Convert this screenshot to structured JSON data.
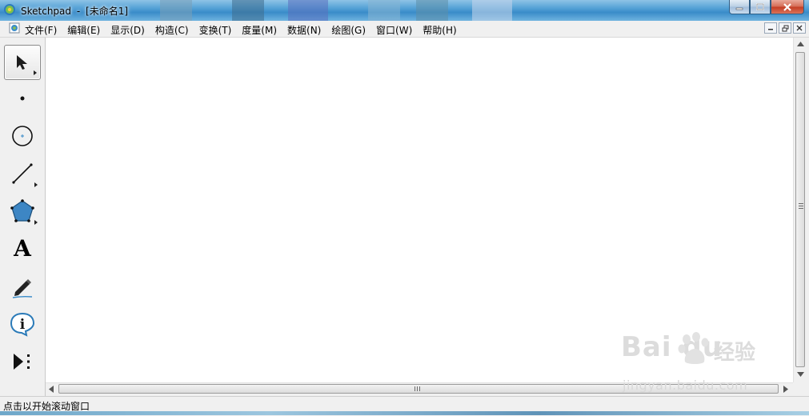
{
  "window": {
    "app_name": "Sketchpad",
    "separator": "-",
    "document": "[未命名1]"
  },
  "menu": {
    "items": [
      {
        "label": "文件(F)"
      },
      {
        "label": "编辑(E)"
      },
      {
        "label": "显示(D)"
      },
      {
        "label": "构造(C)"
      },
      {
        "label": "变换(T)"
      },
      {
        "label": "度量(M)"
      },
      {
        "label": "数据(N)"
      },
      {
        "label": "绘图(G)"
      },
      {
        "label": "窗口(W)"
      },
      {
        "label": "帮助(H)"
      }
    ]
  },
  "toolbox": {
    "tools": [
      {
        "icon": "arrow-select-icon",
        "selected": true
      },
      {
        "icon": "point-icon"
      },
      {
        "icon": "compass-circle-icon"
      },
      {
        "icon": "straightedge-icon"
      },
      {
        "icon": "polygon-icon"
      },
      {
        "icon": "text-tool-icon",
        "glyph": "A"
      },
      {
        "icon": "marker-icon"
      },
      {
        "icon": "information-icon"
      },
      {
        "icon": "custom-tool-icon"
      }
    ]
  },
  "status": {
    "text": "点击以开始滚动窗口"
  },
  "watermark": {
    "brand": "Bai du",
    "product": "经验",
    "url": "jingyan.baidu.com"
  },
  "colors": {
    "accent_blue": "#3a8cc9",
    "canvas": "#ffffff",
    "chrome": "#f0f0f0",
    "polygon_fill": "#3d86c4"
  }
}
